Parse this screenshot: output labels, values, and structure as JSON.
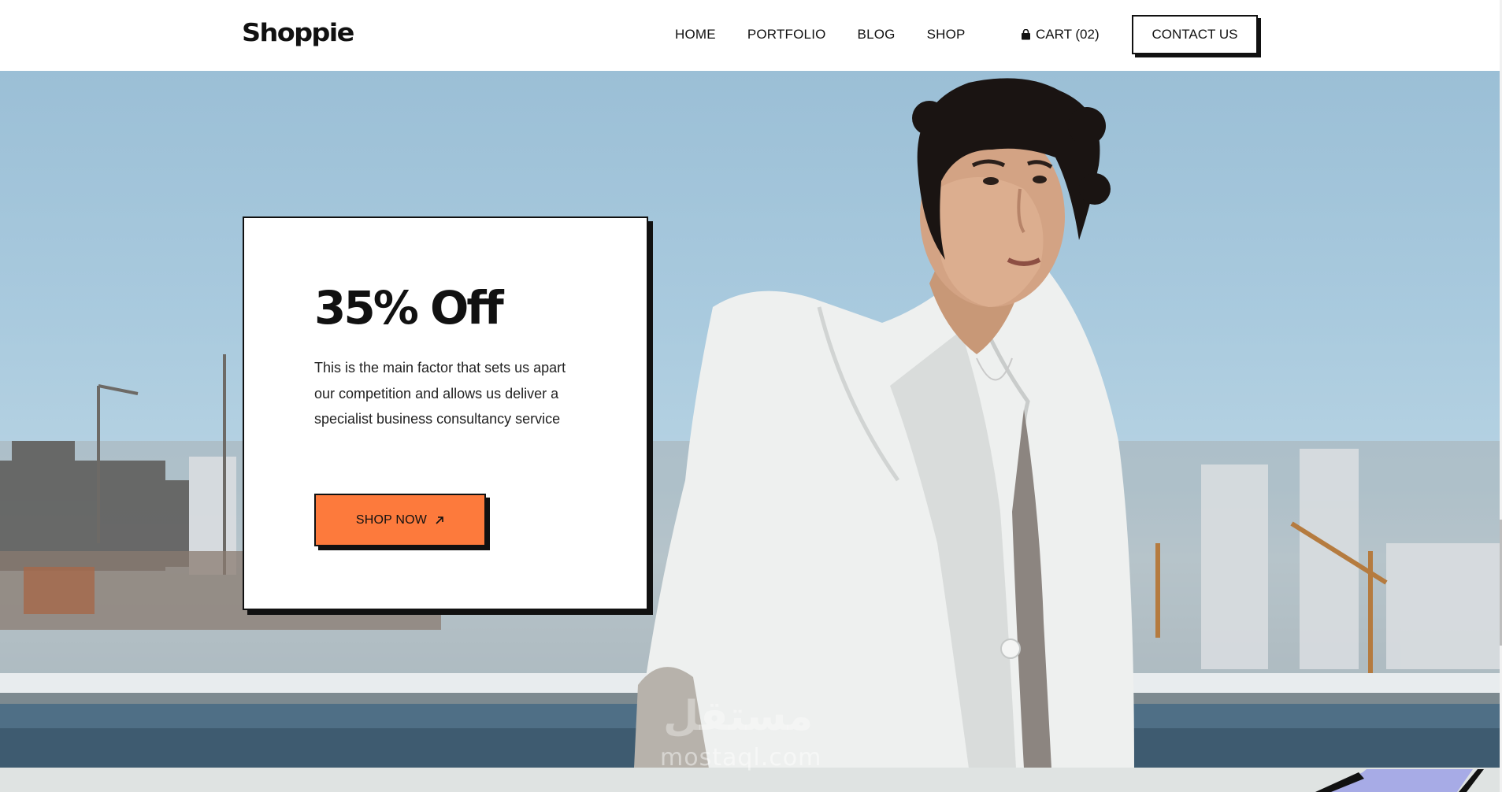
{
  "header": {
    "logo": "Shoppie",
    "nav": [
      {
        "label": "HOME"
      },
      {
        "label": "PORTFOLIO"
      },
      {
        "label": "BLOG"
      },
      {
        "label": "SHOP"
      }
    ],
    "cart_label": "CART (02)",
    "cart_icon": "bag-icon",
    "contact_label": "CONTACT US"
  },
  "hero": {
    "title": "35% Off",
    "description": "This is the main factor that sets us apart our competition and allows us deliver a specialist business consultancy service",
    "cta_label": "SHOP NOW",
    "cta_icon": "arrow-up-right-icon",
    "accent_color": "#fd7a3c"
  },
  "watermark": {
    "arabic": "مستقل",
    "latin": "mostaql.com"
  }
}
